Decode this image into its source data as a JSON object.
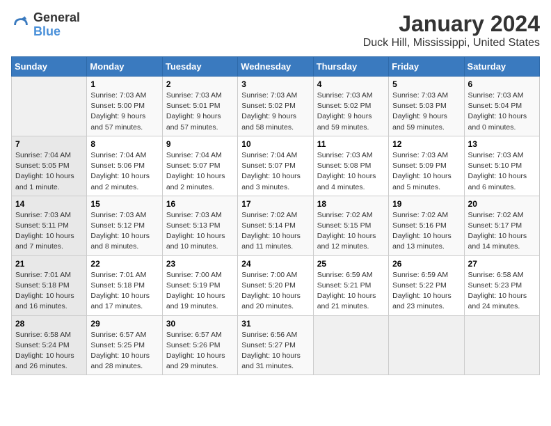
{
  "header": {
    "logo_line1": "General",
    "logo_line2": "Blue",
    "title": "January 2024",
    "subtitle": "Duck Hill, Mississippi, United States"
  },
  "days_of_week": [
    "Sunday",
    "Monday",
    "Tuesday",
    "Wednesday",
    "Thursday",
    "Friday",
    "Saturday"
  ],
  "weeks": [
    [
      {
        "day": "",
        "info": ""
      },
      {
        "day": "1",
        "info": "Sunrise: 7:03 AM\nSunset: 5:00 PM\nDaylight: 9 hours\nand 57 minutes."
      },
      {
        "day": "2",
        "info": "Sunrise: 7:03 AM\nSunset: 5:01 PM\nDaylight: 9 hours\nand 57 minutes."
      },
      {
        "day": "3",
        "info": "Sunrise: 7:03 AM\nSunset: 5:02 PM\nDaylight: 9 hours\nand 58 minutes."
      },
      {
        "day": "4",
        "info": "Sunrise: 7:03 AM\nSunset: 5:02 PM\nDaylight: 9 hours\nand 59 minutes."
      },
      {
        "day": "5",
        "info": "Sunrise: 7:03 AM\nSunset: 5:03 PM\nDaylight: 9 hours\nand 59 minutes."
      },
      {
        "day": "6",
        "info": "Sunrise: 7:03 AM\nSunset: 5:04 PM\nDaylight: 10 hours\nand 0 minutes."
      }
    ],
    [
      {
        "day": "7",
        "info": "Sunrise: 7:04 AM\nSunset: 5:05 PM\nDaylight: 10 hours\nand 1 minute."
      },
      {
        "day": "8",
        "info": "Sunrise: 7:04 AM\nSunset: 5:06 PM\nDaylight: 10 hours\nand 2 minutes."
      },
      {
        "day": "9",
        "info": "Sunrise: 7:04 AM\nSunset: 5:07 PM\nDaylight: 10 hours\nand 2 minutes."
      },
      {
        "day": "10",
        "info": "Sunrise: 7:04 AM\nSunset: 5:07 PM\nDaylight: 10 hours\nand 3 minutes."
      },
      {
        "day": "11",
        "info": "Sunrise: 7:03 AM\nSunset: 5:08 PM\nDaylight: 10 hours\nand 4 minutes."
      },
      {
        "day": "12",
        "info": "Sunrise: 7:03 AM\nSunset: 5:09 PM\nDaylight: 10 hours\nand 5 minutes."
      },
      {
        "day": "13",
        "info": "Sunrise: 7:03 AM\nSunset: 5:10 PM\nDaylight: 10 hours\nand 6 minutes."
      }
    ],
    [
      {
        "day": "14",
        "info": "Sunrise: 7:03 AM\nSunset: 5:11 PM\nDaylight: 10 hours\nand 7 minutes."
      },
      {
        "day": "15",
        "info": "Sunrise: 7:03 AM\nSunset: 5:12 PM\nDaylight: 10 hours\nand 8 minutes."
      },
      {
        "day": "16",
        "info": "Sunrise: 7:03 AM\nSunset: 5:13 PM\nDaylight: 10 hours\nand 10 minutes."
      },
      {
        "day": "17",
        "info": "Sunrise: 7:02 AM\nSunset: 5:14 PM\nDaylight: 10 hours\nand 11 minutes."
      },
      {
        "day": "18",
        "info": "Sunrise: 7:02 AM\nSunset: 5:15 PM\nDaylight: 10 hours\nand 12 minutes."
      },
      {
        "day": "19",
        "info": "Sunrise: 7:02 AM\nSunset: 5:16 PM\nDaylight: 10 hours\nand 13 minutes."
      },
      {
        "day": "20",
        "info": "Sunrise: 7:02 AM\nSunset: 5:17 PM\nDaylight: 10 hours\nand 14 minutes."
      }
    ],
    [
      {
        "day": "21",
        "info": "Sunrise: 7:01 AM\nSunset: 5:18 PM\nDaylight: 10 hours\nand 16 minutes."
      },
      {
        "day": "22",
        "info": "Sunrise: 7:01 AM\nSunset: 5:18 PM\nDaylight: 10 hours\nand 17 minutes."
      },
      {
        "day": "23",
        "info": "Sunrise: 7:00 AM\nSunset: 5:19 PM\nDaylight: 10 hours\nand 19 minutes."
      },
      {
        "day": "24",
        "info": "Sunrise: 7:00 AM\nSunset: 5:20 PM\nDaylight: 10 hours\nand 20 minutes."
      },
      {
        "day": "25",
        "info": "Sunrise: 6:59 AM\nSunset: 5:21 PM\nDaylight: 10 hours\nand 21 minutes."
      },
      {
        "day": "26",
        "info": "Sunrise: 6:59 AM\nSunset: 5:22 PM\nDaylight: 10 hours\nand 23 minutes."
      },
      {
        "day": "27",
        "info": "Sunrise: 6:58 AM\nSunset: 5:23 PM\nDaylight: 10 hours\nand 24 minutes."
      }
    ],
    [
      {
        "day": "28",
        "info": "Sunrise: 6:58 AM\nSunset: 5:24 PM\nDaylight: 10 hours\nand 26 minutes."
      },
      {
        "day": "29",
        "info": "Sunrise: 6:57 AM\nSunset: 5:25 PM\nDaylight: 10 hours\nand 28 minutes."
      },
      {
        "day": "30",
        "info": "Sunrise: 6:57 AM\nSunset: 5:26 PM\nDaylight: 10 hours\nand 29 minutes."
      },
      {
        "day": "31",
        "info": "Sunrise: 6:56 AM\nSunset: 5:27 PM\nDaylight: 10 hours\nand 31 minutes."
      },
      {
        "day": "",
        "info": ""
      },
      {
        "day": "",
        "info": ""
      },
      {
        "day": "",
        "info": ""
      }
    ]
  ]
}
